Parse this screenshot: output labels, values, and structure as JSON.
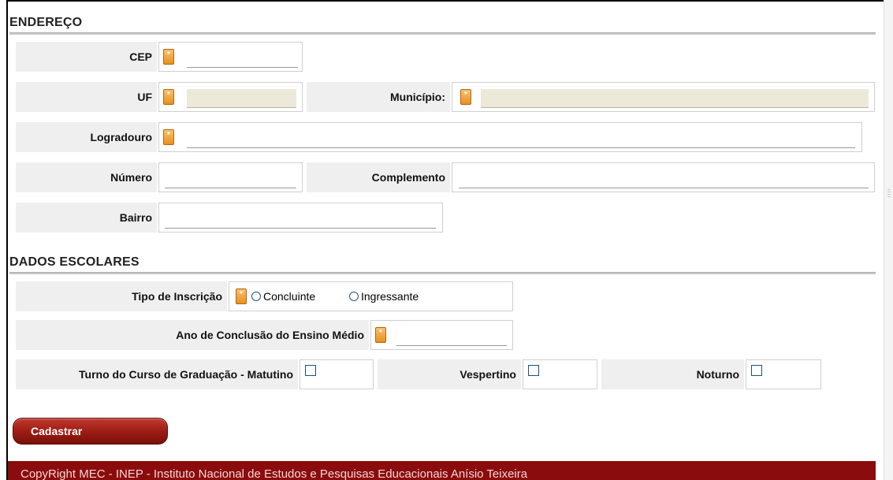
{
  "address": {
    "heading": "ENDEREÇO",
    "cep_label": "CEP",
    "uf_label": "UF",
    "municipio_label": "Município:",
    "logradouro_label": "Logradouro",
    "numero_label": "Número",
    "complemento_label": "Complemento",
    "bairro_label": "Bairro",
    "required_mark": "*"
  },
  "school": {
    "heading": "DADOS ESCOLARES",
    "tipo_label": "Tipo de Inscrição",
    "tipo_options": [
      "Concluinte",
      "Ingressante"
    ],
    "ano_label": "Ano de Conclusão do Ensino Médio",
    "turno_label": "Turno do Curso de Graduação - Matutino",
    "vespertino_label": "Vespertino",
    "noturno_label": "Noturno"
  },
  "actions": {
    "submit_label": "Cadastrar"
  },
  "footer": {
    "text": "CopyRight MEC - INEP - Instituto Nacional de Estudos e Pesquisas Educacionais Anísio Teixeira"
  },
  "colors": {
    "footer_bg": "#8b0c0c",
    "button_bg": "#9d1d15",
    "required_icon": "#e89020",
    "label_bg": "#efefef"
  }
}
